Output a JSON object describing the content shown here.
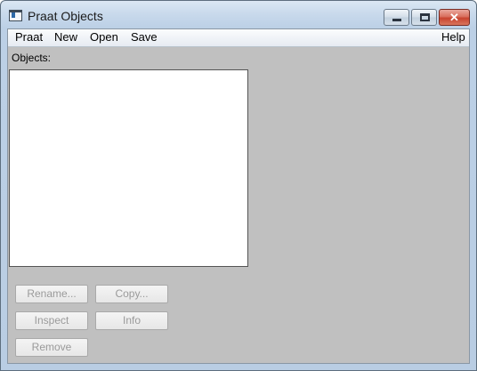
{
  "window": {
    "title": "Praat Objects"
  },
  "menubar": {
    "items": [
      {
        "label": "Praat"
      },
      {
        "label": "New"
      },
      {
        "label": "Open"
      },
      {
        "label": "Save"
      }
    ],
    "help_label": "Help"
  },
  "objects": {
    "label": "Objects:"
  },
  "buttons": {
    "rename": "Rename...",
    "copy": "Copy...",
    "inspect": "Inspect",
    "info": "Info",
    "remove": "Remove"
  }
}
